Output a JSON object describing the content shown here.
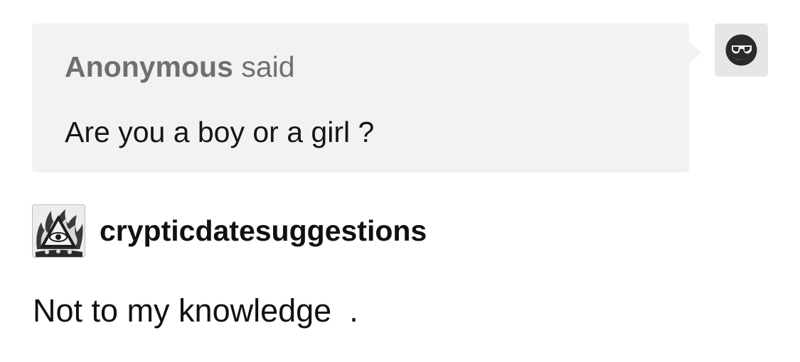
{
  "ask": {
    "asker_name": "Anonymous",
    "said_label": "said",
    "question": "Are you a boy or a girl ?"
  },
  "answer": {
    "blog_name": "crypticdatesuggestions",
    "text": "Not to my knowledge  ."
  },
  "icons": {
    "asker_avatar": "sunglasses-face-icon",
    "blog_avatar": "all-seeing-eye-pyramid-icon"
  },
  "colors": {
    "bubble_background": "#f2f2f2",
    "asker_text": "#6f6f6f",
    "body_text": "#111111"
  }
}
